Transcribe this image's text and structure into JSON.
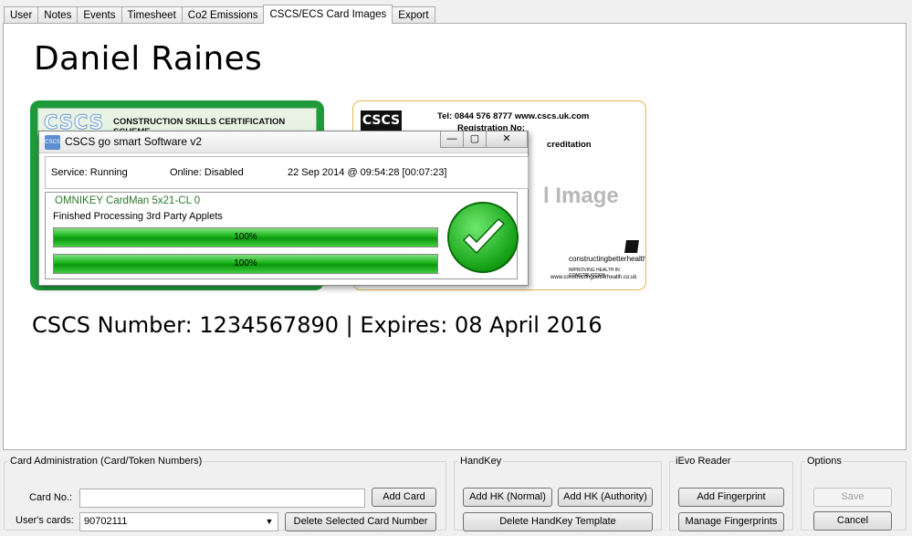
{
  "tabs": [
    "User",
    "Notes",
    "Events",
    "Timesheet",
    "Co2 Emissions",
    "CSCS/ECS Card Images",
    "Export"
  ],
  "active_tab": "CSCS/ECS Card Images",
  "person_name": "Daniel Raines",
  "card_info": "CSCS Number: 1234567890 | Expires: 08 April 2016",
  "card_front": {
    "logo": "CSCS",
    "scheme": "CONSTRUCTION SKILLS CERTIFICATION SCHEME"
  },
  "card_back": {
    "logo": "CSCS",
    "phone_line": "Tel: 0844 576 8777 www.cscs.uk.com",
    "registration": "Registration No:",
    "accreditation": "creditation",
    "placeholder": "l Image",
    "partner": "constructingbetterhealth",
    "partner_sub": "IMPROVING HEALTH IN CONSTRUCTION",
    "partner_url": "www.constructingbetterhealth.co.uk"
  },
  "dialog": {
    "icon": "CSCS",
    "title": "CSCS go smart Software v2",
    "service": "Service: Running",
    "online": "Online: Disabled",
    "timestamp": "22 Sep 2014 @ 09:54:28 [00:07:23]",
    "reader": "OMNIKEY CardMan 5x21-CL 0",
    "reader_status": "Finished Processing 3rd Party Applets",
    "progress": [
      {
        "label": "100%",
        "value": 1.0
      },
      {
        "label": "100%",
        "value": 1.0
      }
    ],
    "minimize": "—",
    "maximize": "▢",
    "close": "✕"
  },
  "card_admin": {
    "legend": "Card Administration (Card/Token Numbers)",
    "card_no_label": "Card No.:",
    "card_no_value": "",
    "add_card": "Add Card",
    "users_cards_label": "User's cards:",
    "users_cards_value": "90702111",
    "delete_card": "Delete Selected Card Number"
  },
  "handkey": {
    "legend": "HandKey",
    "add_normal": "Add HK (Normal)",
    "add_authority": "Add HK (Authority)",
    "delete_template": "Delete HandKey Template"
  },
  "ievo": {
    "legend": "iEvo Reader",
    "add_fingerprint": "Add Fingerprint",
    "manage_fingerprints": "Manage Fingerprints"
  },
  "options": {
    "legend": "Options",
    "save": "Save",
    "cancel": "Cancel"
  },
  "colors": {
    "card_green": "#1e9a3a",
    "progress_green": "#18b418",
    "reader_text": "#2c7a2c"
  }
}
